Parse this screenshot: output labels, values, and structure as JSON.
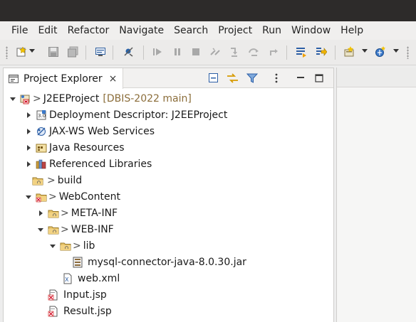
{
  "menu": [
    "File",
    "Edit",
    "Refactor",
    "Navigate",
    "Search",
    "Project",
    "Run",
    "Window",
    "Help"
  ],
  "view": {
    "title": "Project Explorer",
    "close_glyph": "×"
  },
  "tree": [
    {
      "label": "J2EEProject",
      "prefix": ">",
      "decoration": "[DBIS-2022 main]",
      "expanded": true
    },
    {
      "label": "Deployment Descriptor: J2EEProject",
      "expanded": false
    },
    {
      "label": "JAX-WS Web Services",
      "expanded": false
    },
    {
      "label": "Java Resources",
      "expanded": false
    },
    {
      "label": "Referenced Libraries",
      "expanded": false
    },
    {
      "label": "build",
      "prefix": ">"
    },
    {
      "label": "WebContent",
      "prefix": ">",
      "expanded": true
    },
    {
      "label": "META-INF",
      "prefix": ">",
      "expanded": false
    },
    {
      "label": "WEB-INF",
      "prefix": ">",
      "expanded": true
    },
    {
      "label": "lib",
      "prefix": ">",
      "expanded": true
    },
    {
      "label": "mysql-connector-java-8.0.30.jar"
    },
    {
      "label": "web.xml"
    },
    {
      "label": "Input.jsp"
    },
    {
      "label": "Result.jsp"
    }
  ],
  "icons": {
    "project": "project-icon",
    "descriptor": "deployment-descriptor-icon",
    "webservices": "web-services-icon",
    "resources": "java-resources-icon",
    "libraries": "library-icon",
    "folder": "folder-icon",
    "jar": "jar-icon",
    "xml": "xml-file-icon",
    "jsp": "jsp-file-icon"
  },
  "colors": {
    "decoration": "#8b6d3a",
    "titlebar": "#2d2b2a",
    "error_badge": "#d0021b"
  }
}
